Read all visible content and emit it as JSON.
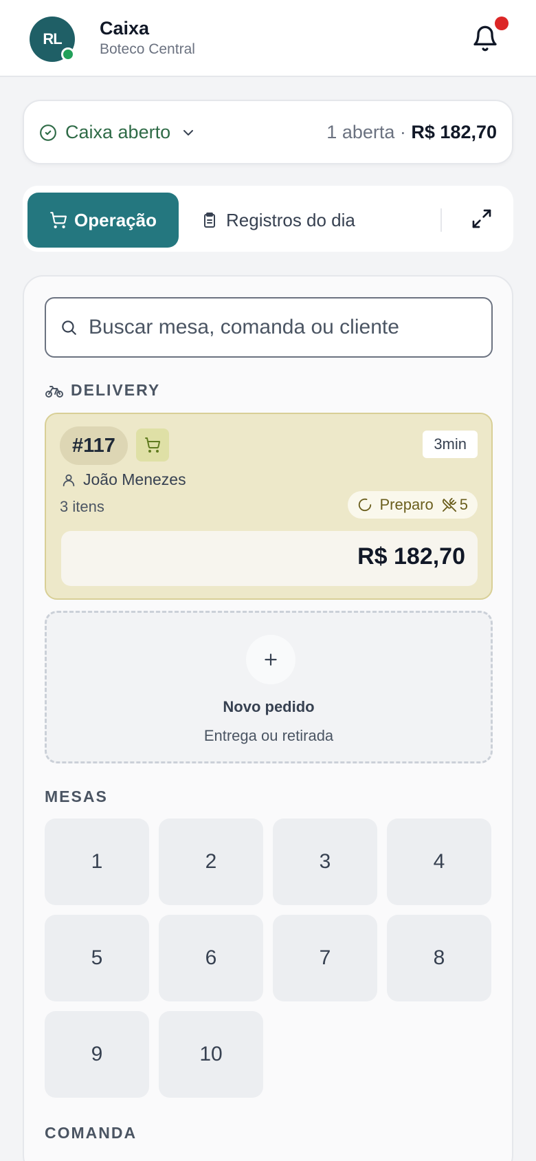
{
  "header": {
    "avatar_initials": "RL",
    "title": "Caixa",
    "subtitle": "Boteco Central",
    "notification_icon": "bell-icon"
  },
  "status_bar": {
    "status_label": "Caixa aberto",
    "open_count": "1 aberta ·",
    "total": "R$ 182,70"
  },
  "tabs": [
    {
      "label": "Operação",
      "icon": "cart-icon",
      "active": true
    },
    {
      "label": "Registros do dia",
      "icon": "clipboard-icon",
      "active": false
    }
  ],
  "search": {
    "placeholder": "Buscar mesa, comanda ou cliente"
  },
  "delivery": {
    "section_label": "DELIVERY",
    "order": {
      "number": "#117",
      "elapsed": "3min",
      "customer": "João Menezes",
      "items": "3 itens",
      "status": "Preparo",
      "kitchen_count": "5",
      "total": "R$ 182,70"
    },
    "new_order": {
      "title": "Novo pedido",
      "subtitle": "Entrega ou retirada"
    }
  },
  "tables": {
    "section_label": "MESAS",
    "items": [
      "1",
      "2",
      "3",
      "4",
      "5",
      "6",
      "7",
      "8",
      "9",
      "10"
    ]
  },
  "comanda": {
    "section_label": "COMANDA"
  },
  "colors": {
    "accent": "#24777f",
    "status_green": "#2f6b47",
    "delivery_card": "#ede8c9",
    "alert": "#dc2626"
  }
}
